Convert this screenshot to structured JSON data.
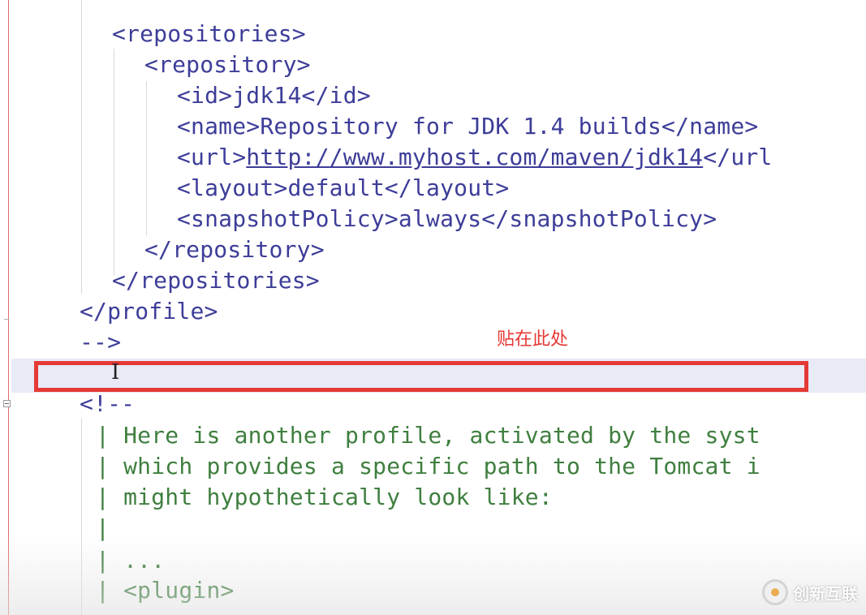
{
  "editor": {
    "lines": {
      "l1": "<repositories>",
      "l2": "<repository>",
      "l3_open": "<id>",
      "l3_val": "jdk14",
      "l3_close": "</id>",
      "l4_open": "<name>",
      "l4_val": "Repository for JDK 1.4 builds",
      "l4_close": "</name>",
      "l5_open": "<url>",
      "l5_val": "http://www.myhost.com/maven/jdk14",
      "l5_close": "</url",
      "l6_open": "<layout>",
      "l6_val": "default",
      "l6_close": "</layout>",
      "l7_open": "<snapshotPolicy>",
      "l7_val": "always",
      "l7_close": "</snapshotPolicy>",
      "l8": "</repository>",
      "l9": "</repositories>",
      "l10": "</profile>",
      "l11": "-->",
      "l13": "<!--",
      "l14": "| Here is another profile, activated by the syst",
      "l15": "| which provides a specific path to the Tomcat i",
      "l16": "| might hypothetically look like:",
      "l17": "|",
      "l18": "| ...",
      "l19": "| <plugin>"
    },
    "colors": {
      "tag": "#3d3d99",
      "comment": "#3f7f3f",
      "annotation": "#e53935"
    }
  },
  "annotation": {
    "label": "贴在此处"
  },
  "watermark": {
    "label": "创新互联",
    "icon": "logo-icon"
  }
}
